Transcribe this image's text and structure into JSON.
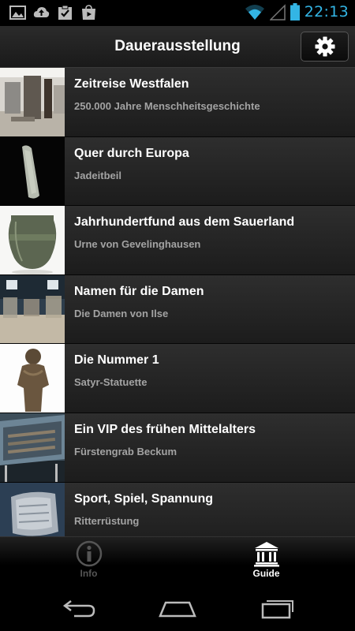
{
  "status_bar": {
    "time": "22:13",
    "icons": [
      "image-icon",
      "cloud-upload-icon",
      "clipboard-check-icon",
      "play-store-icon",
      "wifi-icon",
      "signal-icon",
      "battery-icon"
    ]
  },
  "action_bar": {
    "title": "Dauerausstellung",
    "settings_icon": "gear-icon"
  },
  "list": [
    {
      "title": "Zeitreise Westfalen",
      "subtitle": "250.000 Jahre Menschheitsgeschichte"
    },
    {
      "title": "Quer durch Europa",
      "subtitle": "Jadeitbeil"
    },
    {
      "title": "Jahrhundertfund aus dem Sauerland",
      "subtitle": "Urne von Gevelinghausen"
    },
    {
      "title": "Namen für die Damen",
      "subtitle": "Die Damen von Ilse"
    },
    {
      "title": "Die Nummer 1",
      "subtitle": "Satyr-Statuette"
    },
    {
      "title": "Ein VIP des frühen Mittelalters",
      "subtitle": "Fürstengrab Beckum"
    },
    {
      "title": "Sport, Spiel, Spannung",
      "subtitle": "Ritterrüstung"
    }
  ],
  "tabs": [
    {
      "label": "Info",
      "icon": "info-icon",
      "active": false
    },
    {
      "label": "Guide",
      "icon": "museum-icon",
      "active": true
    }
  ],
  "nav_bar": {
    "icons": [
      "back-icon",
      "home-icon",
      "recent-apps-icon"
    ]
  },
  "colors": {
    "accent": "#33b5e5",
    "subtitle": "#a3a3a3",
    "inactive_tab": "#555555"
  }
}
